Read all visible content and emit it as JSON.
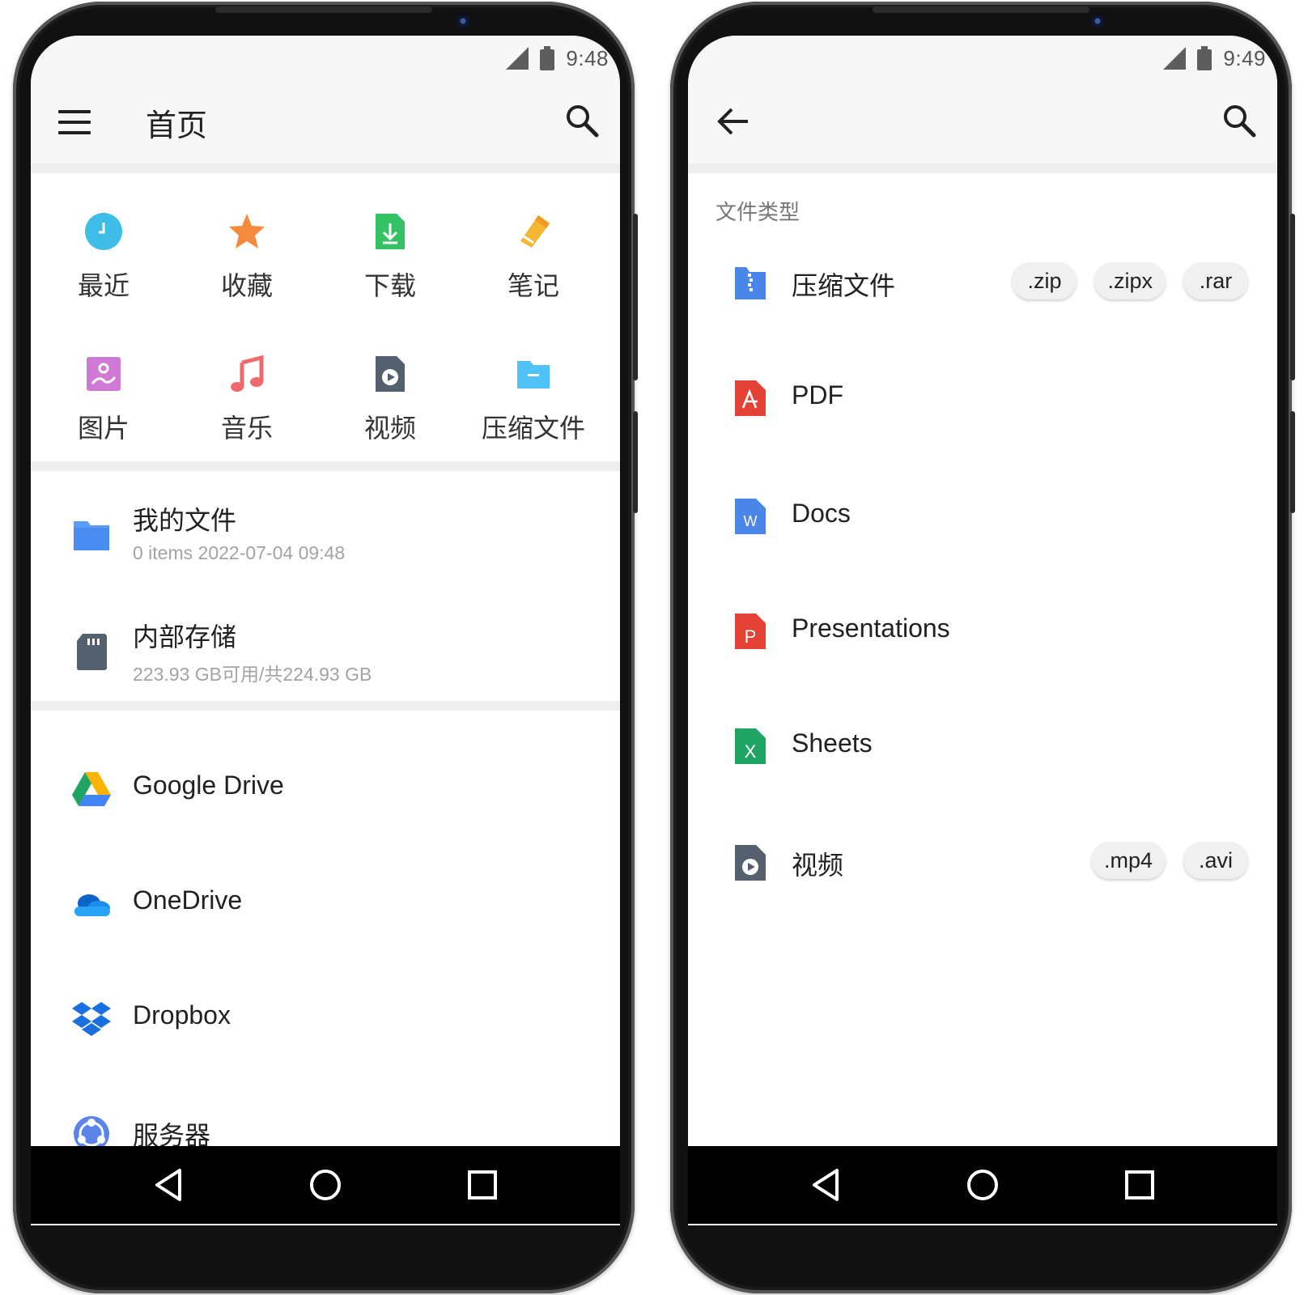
{
  "left_screen": {
    "status": {
      "time": "9:48"
    },
    "appbar": {
      "title": "首页"
    },
    "categories": [
      {
        "label": "最近",
        "icon": "clock-icon",
        "color": "#3fbde9"
      },
      {
        "label": "收藏",
        "icon": "star-icon",
        "color": "#f58a3c"
      },
      {
        "label": "下载",
        "icon": "download-icon",
        "color": "#34c264"
      },
      {
        "label": "笔记",
        "icon": "pencil-icon",
        "color": "#f5b731"
      },
      {
        "label": "图片",
        "icon": "image-icon",
        "color": "#cf7bd6"
      },
      {
        "label": "音乐",
        "icon": "music-icon",
        "color": "#ef6b6b"
      },
      {
        "label": "视频",
        "icon": "video-icon",
        "color": "#54606e"
      },
      {
        "label": "压缩文件",
        "icon": "archive-folder-icon",
        "color": "#4fc3f7"
      }
    ],
    "storage": [
      {
        "title": "我的文件",
        "subtitle": "0 items  2022-07-04 09:48",
        "icon": "folder-icon"
      },
      {
        "title": "内部存储",
        "subtitle": "223.93 GB可用/共224.93 GB",
        "icon": "sd-card-icon"
      }
    ],
    "cloud": [
      {
        "label": "Google Drive",
        "icon": "google-drive-icon"
      },
      {
        "label": "OneDrive",
        "icon": "onedrive-icon"
      },
      {
        "label": "Dropbox",
        "icon": "dropbox-icon"
      },
      {
        "label": "服务器",
        "icon": "server-icon"
      }
    ]
  },
  "right_screen": {
    "status": {
      "time": "9:49"
    },
    "section_label": "文件类型",
    "types": [
      {
        "label": "压缩文件",
        "icon": "zip-file-icon",
        "color": "#4a86e8",
        "chips": [
          ".zip",
          ".zipx",
          ".rar"
        ]
      },
      {
        "label": "PDF",
        "icon": "pdf-file-icon",
        "color": "#e34234",
        "chips": []
      },
      {
        "label": "Docs",
        "icon": "docs-file-icon",
        "color": "#4a86e8",
        "chips": []
      },
      {
        "label": "Presentations",
        "icon": "slides-file-icon",
        "color": "#e34234",
        "chips": []
      },
      {
        "label": "Sheets",
        "icon": "sheets-file-icon",
        "color": "#1fa463",
        "chips": []
      },
      {
        "label": "视频",
        "icon": "video-file-icon",
        "color": "#54606e",
        "chips": [
          ".mp4",
          ".avi"
        ]
      }
    ]
  },
  "navbar": {
    "buttons": [
      "back-nav-icon",
      "home-nav-icon",
      "recents-nav-icon"
    ]
  }
}
